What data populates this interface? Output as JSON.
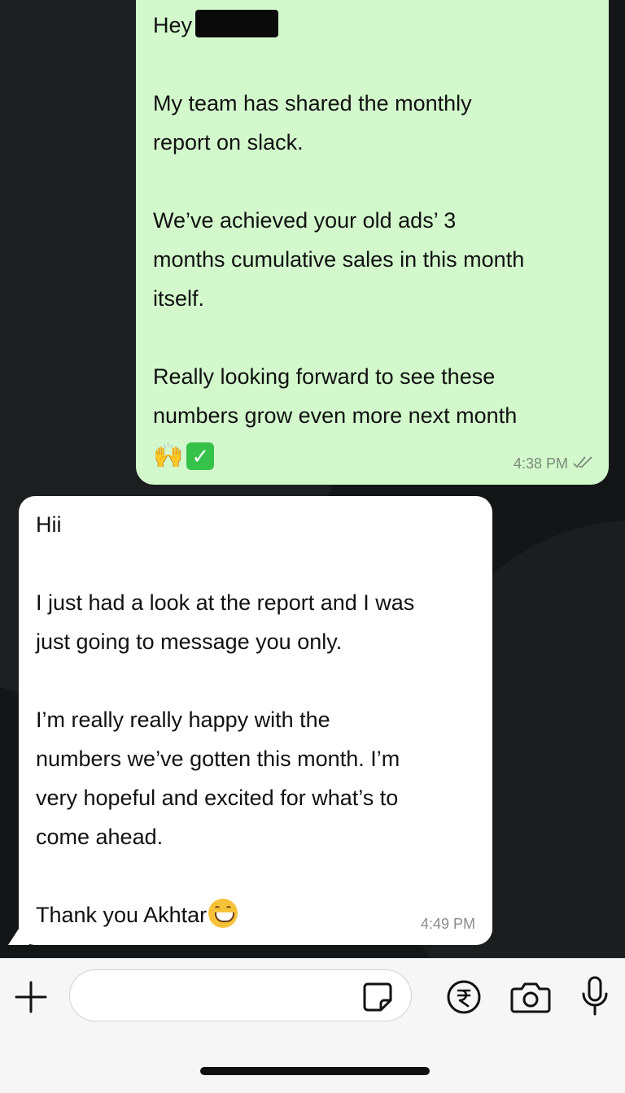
{
  "chat": {
    "outgoing": {
      "greeting": "Hey",
      "lines": [
        "My team has shared the monthly",
        "report on slack.",
        "We’ve achieved your old ads’ 3",
        "months cumulative sales in this month",
        "itself.",
        "Really looking forward to see these",
        "numbers grow even more next month"
      ],
      "emoji_icons": [
        "raising-hands-icon",
        "check-mark-button-icon"
      ],
      "time": "4:38 PM",
      "status_icon": "double-check-read-icon"
    },
    "incoming": {
      "lines": [
        "Hii",
        "I just had a look at the report and I was",
        "just going to message you only.",
        "I’m really really happy with the",
        "numbers we’ve gotten this month. I’m",
        "very hopeful and excited for what’s to",
        "come ahead.",
        "Thank you Akhtar"
      ],
      "emoji_icon": "grinning-face-icon",
      "time": "4:49 PM"
    }
  },
  "input_bar": {
    "message_value": "",
    "icons": [
      "plus-icon",
      "sticker-icon",
      "rupee-payment-icon",
      "camera-icon",
      "microphone-icon"
    ]
  },
  "colors": {
    "outgoing_bubble": "#d2f8cc",
    "incoming_bubble": "#ffffff",
    "chat_background": "#141516",
    "input_bar_background": "#f6f6f6"
  }
}
